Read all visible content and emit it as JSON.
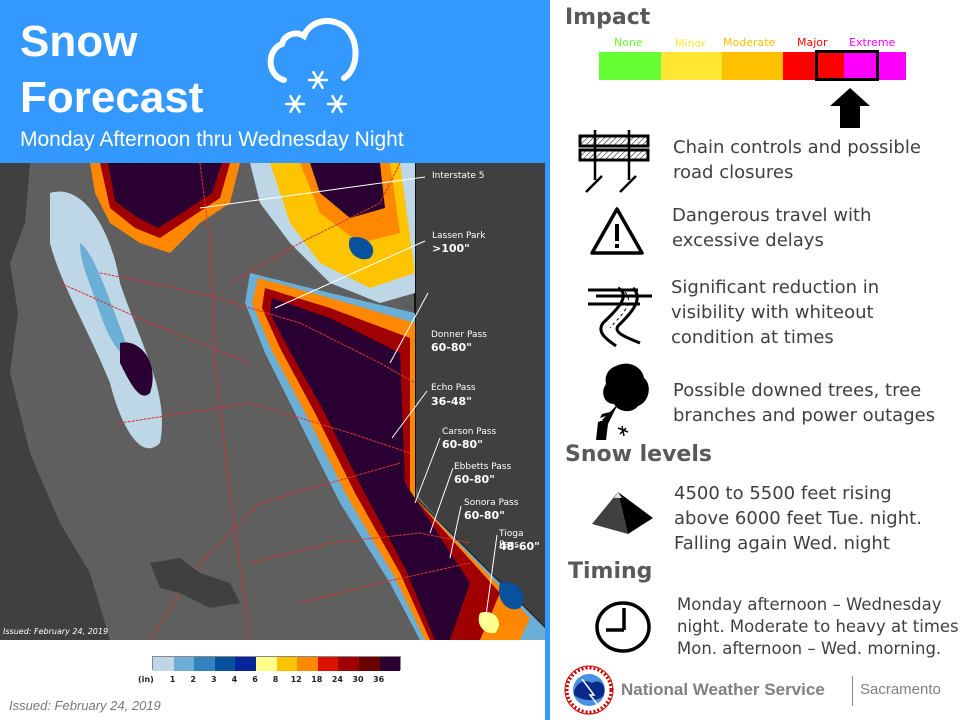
{
  "header": {
    "title_line1": "Snow",
    "title_line2": "Forecast",
    "subtitle": "Monday Afternoon thru Wednesday Night",
    "icon": "cloud-snow-icon",
    "background_color": "#3399ff"
  },
  "map": {
    "labels": [
      {
        "name": "Interstate 5",
        "value": ""
      },
      {
        "name": "Lassen Park",
        "value": ">100\""
      },
      {
        "name": "Donner Pass",
        "value": "60-80\""
      },
      {
        "name": "Echo Pass",
        "value": "36-48\""
      },
      {
        "name": "Carson Pass",
        "value": "60-80\""
      },
      {
        "name": "Ebbetts Pass",
        "value": "60-80\""
      },
      {
        "name": "Sonora Pass",
        "value": "60-80\""
      },
      {
        "name": "Tioga Pass",
        "value": "48-60\""
      }
    ],
    "issued": "Issued: February 24, 2019"
  },
  "legend": {
    "unit": "(in)",
    "ticks": [
      "1",
      "2",
      "3",
      "4",
      "6",
      "8",
      "12",
      "18",
      "24",
      "30",
      "36"
    ],
    "colors": [
      "#bdd7e7",
      "#6baed6",
      "#3182bd",
      "#08519c",
      "#08269a",
      "#ffff8c",
      "#ffc400",
      "#ff8800",
      "#dd1100",
      "#a00000",
      "#6a0000",
      "#2a0033"
    ]
  },
  "issued_footer": "Issued: February 24, 2019",
  "impact": {
    "heading": "Impact",
    "levels": [
      {
        "label": "None",
        "color": "#66ff33"
      },
      {
        "label": "Minor",
        "color": "#ffe633"
      },
      {
        "label": "Moderate",
        "color": "#ffc000"
      },
      {
        "label": "Major",
        "color": "#ff0000"
      },
      {
        "label": "Extreme",
        "color": "#ff00ff"
      }
    ],
    "selected_range": "Major-Extreme",
    "indicator": "up-arrow-icon"
  },
  "impacts_list": [
    {
      "icon": "road-barrier-icon",
      "text_line1": "Chain controls and possible",
      "text_line2": "road closures"
    },
    {
      "icon": "warning-triangle-icon",
      "text_line1": "Dangerous travel with",
      "text_line2": "excessive delays"
    },
    {
      "icon": "whiteout-road-icon",
      "text_line1": "Significant reduction in",
      "text_line2": "visibility with whiteout",
      "text_line3": "condition at times"
    },
    {
      "icon": "fallen-tree-icon",
      "text_line1": "Possible downed trees, tree",
      "text_line2": "branches and power outages"
    }
  ],
  "snow_levels": {
    "heading": "Snow levels",
    "icon": "mountain-pyramid-icon",
    "text_line1": "4500 to 5500 feet rising",
    "text_line2": "above 6000 feet Tue. night.",
    "text_line3": "Falling again Wed. night"
  },
  "timing": {
    "heading": "Timing",
    "icon": "clock-icon",
    "text_line1": "Monday afternoon – Wednesday",
    "text_line2": "night. Moderate to heavy at times",
    "text_line3": "Mon. afternoon – Wed. morning."
  },
  "footer": {
    "agency": "National Weather Service",
    "office": "Sacramento",
    "logo": "nws-logo"
  }
}
